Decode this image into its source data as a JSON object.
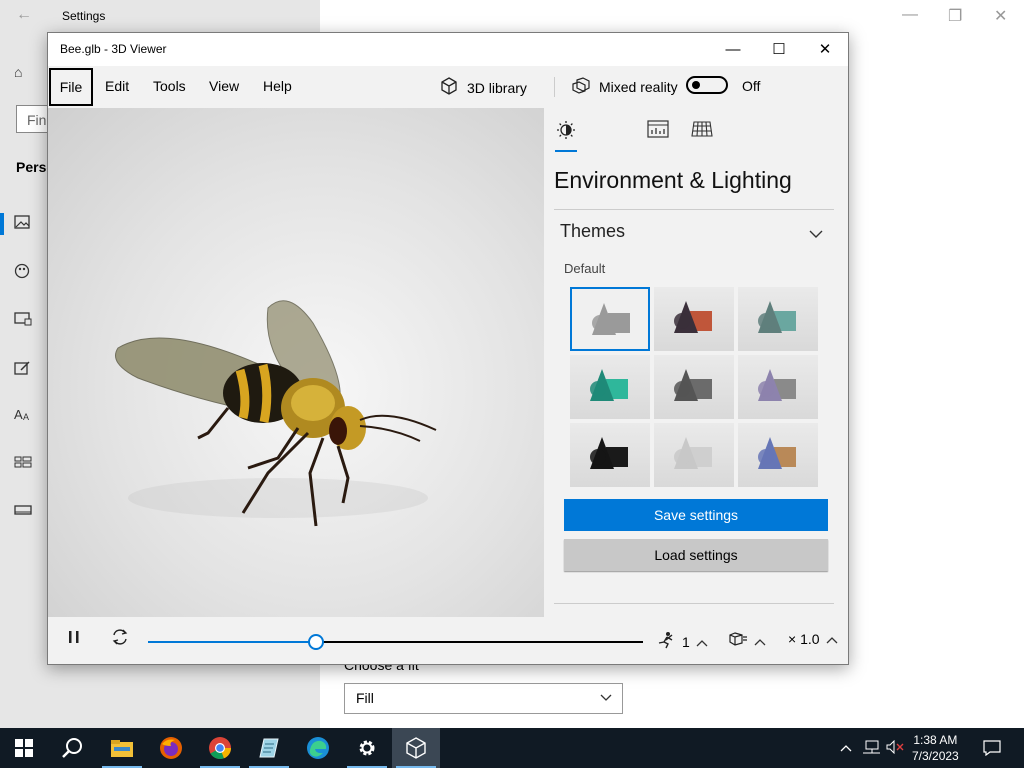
{
  "settings": {
    "title": "Settings",
    "find_placeholder": "Fin",
    "section_label": "Perso",
    "fit_label": "Choose a fit",
    "fit_value": "Fill"
  },
  "viewer": {
    "title": "Bee.glb - 3D Viewer",
    "menu": [
      "File",
      "Edit",
      "Tools",
      "View",
      "Help"
    ],
    "library_label": "3D library",
    "mixed_reality_label": "Mixed reality",
    "mixed_reality_state": "Off",
    "panel": {
      "title": "Environment & Lighting",
      "themes_label": "Themes",
      "default_label": "Default",
      "save_label": "Save settings",
      "load_label": "Load settings",
      "theme_tiles": [
        {
          "name": "default",
          "cone": "#9a9a9a",
          "box": "#9a9a9a",
          "selected": true
        },
        {
          "name": "warm",
          "cone": "#3a2f3a",
          "box": "#c0563a",
          "selected": false
        },
        {
          "name": "teal-gray",
          "cone": "#5f7f7c",
          "box": "#6aa7a0",
          "selected": false
        },
        {
          "name": "green",
          "cone": "#1f8a78",
          "box": "#2fb79b",
          "selected": false
        },
        {
          "name": "dark-gray",
          "cone": "#555",
          "box": "#6b6b6b",
          "selected": false
        },
        {
          "name": "lavender",
          "cone": "#8d83ad",
          "box": "#8a8a8a",
          "selected": false
        },
        {
          "name": "black",
          "cone": "#151515",
          "box": "#1a1a1a",
          "selected": false
        },
        {
          "name": "light",
          "cone": "#c8c8c8",
          "box": "#cfcfcf",
          "selected": false
        },
        {
          "name": "gold-blue",
          "cone": "#6676b6",
          "box": "#b98958",
          "selected": false
        }
      ]
    },
    "playback": {
      "progress": 0.34,
      "animation_count": "1",
      "speed": "× 1.0"
    }
  },
  "taskbar": {
    "time": "1:38 AM",
    "date": "7/3/2023"
  },
  "colors": {
    "accent": "#0078d7"
  }
}
